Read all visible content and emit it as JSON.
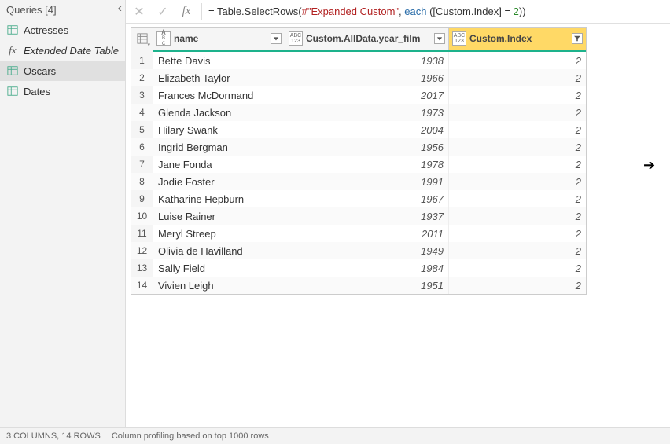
{
  "sidebar": {
    "title": "Queries [4]",
    "items": [
      {
        "label": "Actresses",
        "icon": "table",
        "selected": false
      },
      {
        "label": "Extended Date Table",
        "icon": "fx",
        "selected": false
      },
      {
        "label": "Oscars",
        "icon": "table",
        "selected": true
      },
      {
        "label": "Dates",
        "icon": "table",
        "selected": false
      }
    ]
  },
  "formula": {
    "prefix": "= Table.SelectRows(",
    "arg_str": "#\"Expanded Custom\"",
    "sep1": ", ",
    "kw_each": "each",
    "mid": " ([Custom.Index] = ",
    "num": "2",
    "suffix": "))"
  },
  "columns": [
    {
      "key": "name",
      "label": "name",
      "type": "text",
      "filtered": false,
      "class": "c-name"
    },
    {
      "key": "year",
      "label": "Custom.AllData.year_film",
      "type": "any",
      "filtered": false,
      "class": "c-year"
    },
    {
      "key": "idx",
      "label": "Custom.Index",
      "type": "any",
      "filtered": true,
      "class": "c-idx"
    }
  ],
  "rows": [
    {
      "name": "Bette Davis",
      "year": 1938,
      "idx": 2
    },
    {
      "name": "Elizabeth Taylor",
      "year": 1966,
      "idx": 2
    },
    {
      "name": "Frances McDormand",
      "year": 2017,
      "idx": 2
    },
    {
      "name": "Glenda Jackson",
      "year": 1973,
      "idx": 2
    },
    {
      "name": "Hilary Swank",
      "year": 2004,
      "idx": 2
    },
    {
      "name": "Ingrid Bergman",
      "year": 1956,
      "idx": 2
    },
    {
      "name": "Jane Fonda",
      "year": 1978,
      "idx": 2
    },
    {
      "name": "Jodie Foster",
      "year": 1991,
      "idx": 2
    },
    {
      "name": "Katharine Hepburn",
      "year": 1967,
      "idx": 2
    },
    {
      "name": "Luise Rainer",
      "year": 1937,
      "idx": 2
    },
    {
      "name": "Meryl Streep",
      "year": 2011,
      "idx": 2
    },
    {
      "name": "Olivia de Havilland",
      "year": 1949,
      "idx": 2
    },
    {
      "name": "Sally Field",
      "year": 1984,
      "idx": 2
    },
    {
      "name": "Vivien Leigh",
      "year": 1951,
      "idx": 2
    }
  ],
  "status": {
    "summary": "3 COLUMNS, 14 ROWS",
    "profiling": "Column profiling based on top 1000 rows"
  }
}
